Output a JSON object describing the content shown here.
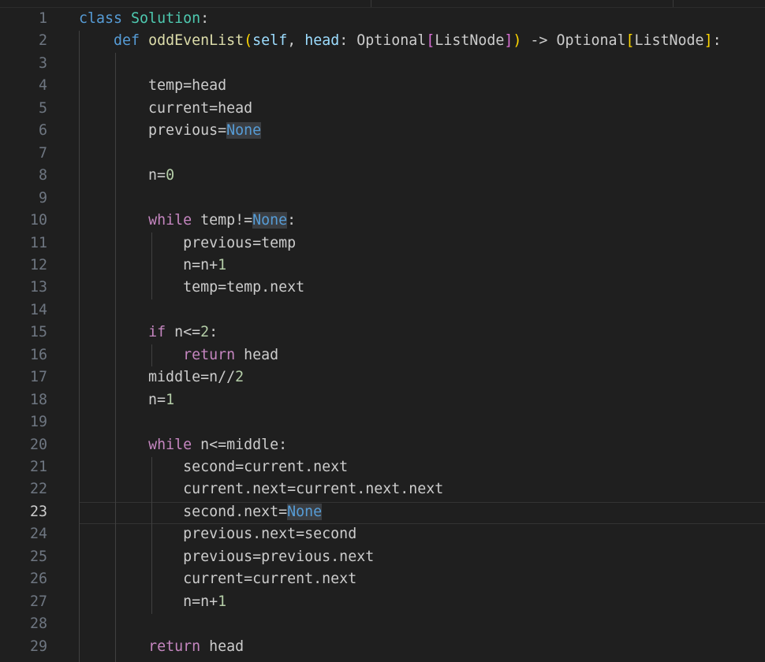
{
  "editor": {
    "language": "python",
    "active_line": "23",
    "colors": {
      "background": "#1f1f1f",
      "line_number": "#6e7681",
      "active_line_number": "#cccccc",
      "keyword": "#569cd6",
      "control": "#c586c0",
      "class_name": "#4ec9b0",
      "function": "#dcdcaa",
      "parameter": "#9cdcfe",
      "number": "#b5cea8",
      "text": "#cccccc",
      "bracket_1": "#ffd700",
      "bracket_2": "#da70d6",
      "selection_highlight": "#3a3d41"
    },
    "lines": [
      {
        "n": "1",
        "tokens": [
          [
            "class",
            "kw"
          ],
          [
            " ",
            "plain"
          ],
          [
            "Solution",
            "cls"
          ],
          [
            ":",
            "plain"
          ]
        ]
      },
      {
        "n": "2",
        "tokens": [
          [
            "    ",
            "plain"
          ],
          [
            "def",
            "kw"
          ],
          [
            " ",
            "plain"
          ],
          [
            "oddEvenList",
            "fn"
          ],
          [
            "(",
            "b1"
          ],
          [
            "self",
            "param"
          ],
          [
            ", ",
            "plain"
          ],
          [
            "head",
            "param"
          ],
          [
            ": Optional",
            "plain"
          ],
          [
            "[",
            "b2"
          ],
          [
            "ListNode",
            "plain"
          ],
          [
            "]",
            "b2"
          ],
          [
            ")",
            "b1"
          ],
          [
            " -> Optional",
            "plain"
          ],
          [
            "[",
            "b1"
          ],
          [
            "ListNode",
            "plain"
          ],
          [
            "]",
            "b1"
          ],
          [
            ":",
            "plain"
          ]
        ]
      },
      {
        "n": "3",
        "tokens": []
      },
      {
        "n": "4",
        "tokens": [
          [
            "        temp=head",
            "plain"
          ]
        ]
      },
      {
        "n": "5",
        "tokens": [
          [
            "        current=head",
            "plain"
          ]
        ]
      },
      {
        "n": "6",
        "tokens": [
          [
            "        previous=",
            "plain"
          ],
          [
            "None",
            "const",
            true
          ]
        ]
      },
      {
        "n": "7",
        "tokens": []
      },
      {
        "n": "8",
        "tokens": [
          [
            "        n=",
            "plain"
          ],
          [
            "0",
            "num"
          ]
        ]
      },
      {
        "n": "9",
        "tokens": []
      },
      {
        "n": "10",
        "tokens": [
          [
            "        ",
            "plain"
          ],
          [
            "while",
            "ctrl"
          ],
          [
            " temp!=",
            "plain"
          ],
          [
            "None",
            "const",
            true
          ],
          [
            ":",
            "plain"
          ]
        ]
      },
      {
        "n": "11",
        "tokens": [
          [
            "            previous=temp",
            "plain"
          ]
        ]
      },
      {
        "n": "12",
        "tokens": [
          [
            "            n=n+",
            "plain"
          ],
          [
            "1",
            "num"
          ]
        ]
      },
      {
        "n": "13",
        "tokens": [
          [
            "            temp=temp.next",
            "plain"
          ]
        ]
      },
      {
        "n": "14",
        "tokens": []
      },
      {
        "n": "15",
        "tokens": [
          [
            "        ",
            "plain"
          ],
          [
            "if",
            "ctrl"
          ],
          [
            " n<=",
            "plain"
          ],
          [
            "2",
            "num"
          ],
          [
            ":",
            "plain"
          ]
        ]
      },
      {
        "n": "16",
        "tokens": [
          [
            "            ",
            "plain"
          ],
          [
            "return",
            "ctrl"
          ],
          [
            " head",
            "plain"
          ]
        ]
      },
      {
        "n": "17",
        "tokens": [
          [
            "        middle=n//",
            "plain"
          ],
          [
            "2",
            "num"
          ]
        ]
      },
      {
        "n": "18",
        "tokens": [
          [
            "        n=",
            "plain"
          ],
          [
            "1",
            "num"
          ]
        ]
      },
      {
        "n": "19",
        "tokens": []
      },
      {
        "n": "20",
        "tokens": [
          [
            "        ",
            "plain"
          ],
          [
            "while",
            "ctrl"
          ],
          [
            " n<=middle:",
            "plain"
          ]
        ]
      },
      {
        "n": "21",
        "tokens": [
          [
            "            second=current.next",
            "plain"
          ]
        ]
      },
      {
        "n": "22",
        "tokens": [
          [
            "            current.next=current.next.next",
            "plain"
          ]
        ]
      },
      {
        "n": "23",
        "tokens": [
          [
            "            second.next=",
            "plain"
          ],
          [
            "None",
            "const",
            true
          ]
        ]
      },
      {
        "n": "24",
        "tokens": [
          [
            "            previous.next=second",
            "plain"
          ]
        ]
      },
      {
        "n": "25",
        "tokens": [
          [
            "            previous=previous.next",
            "plain"
          ]
        ]
      },
      {
        "n": "26",
        "tokens": [
          [
            "            current=current.next",
            "plain"
          ]
        ]
      },
      {
        "n": "27",
        "tokens": [
          [
            "            n=n+",
            "plain"
          ],
          [
            "1",
            "num"
          ]
        ]
      },
      {
        "n": "28",
        "tokens": []
      },
      {
        "n": "29",
        "tokens": [
          [
            "        ",
            "plain"
          ],
          [
            "return",
            "ctrl"
          ],
          [
            " head",
            "plain"
          ]
        ]
      }
    ]
  }
}
